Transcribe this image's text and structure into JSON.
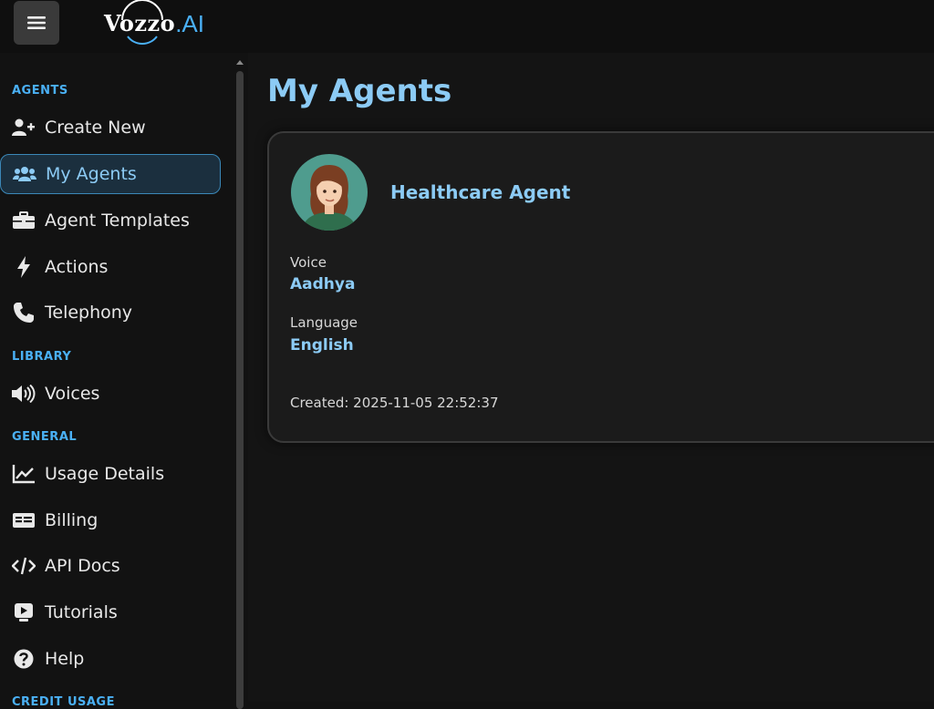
{
  "brand": {
    "name": "Vozzo",
    "suffix": ".AI"
  },
  "sidebar": {
    "sections": {
      "agents": "AGENTS",
      "library": "LIBRARY",
      "general": "GENERAL",
      "credit": "CREDIT USAGE"
    },
    "items": [
      {
        "label": "Create New",
        "icon": "user-plus-icon"
      },
      {
        "label": "My Agents",
        "icon": "users-icon"
      },
      {
        "label": "Agent Templates",
        "icon": "briefcase-icon"
      },
      {
        "label": "Actions",
        "icon": "bolt-icon"
      },
      {
        "label": "Telephony",
        "icon": "phone-icon"
      },
      {
        "label": "Voices",
        "icon": "volume-icon"
      },
      {
        "label": "Usage Details",
        "icon": "line-chart-icon"
      },
      {
        "label": "Billing",
        "icon": "id-card-icon"
      },
      {
        "label": "API Docs",
        "icon": "code-icon"
      },
      {
        "label": "Tutorials",
        "icon": "video-icon"
      },
      {
        "label": "Help",
        "icon": "question-circle-icon"
      }
    ]
  },
  "main": {
    "title": "My Agents",
    "agents": [
      {
        "name": "Healthcare Agent",
        "voice_label": "Voice",
        "voice": "Aadhya",
        "language_label": "Language",
        "language": "English",
        "created": "Created: 2025-11-05 22:52:37"
      }
    ]
  },
  "colors": {
    "accent": "#4ab0f5",
    "accent_light": "#8ccbf5",
    "background": "#121212",
    "active_bg": "#1b2f3e"
  }
}
